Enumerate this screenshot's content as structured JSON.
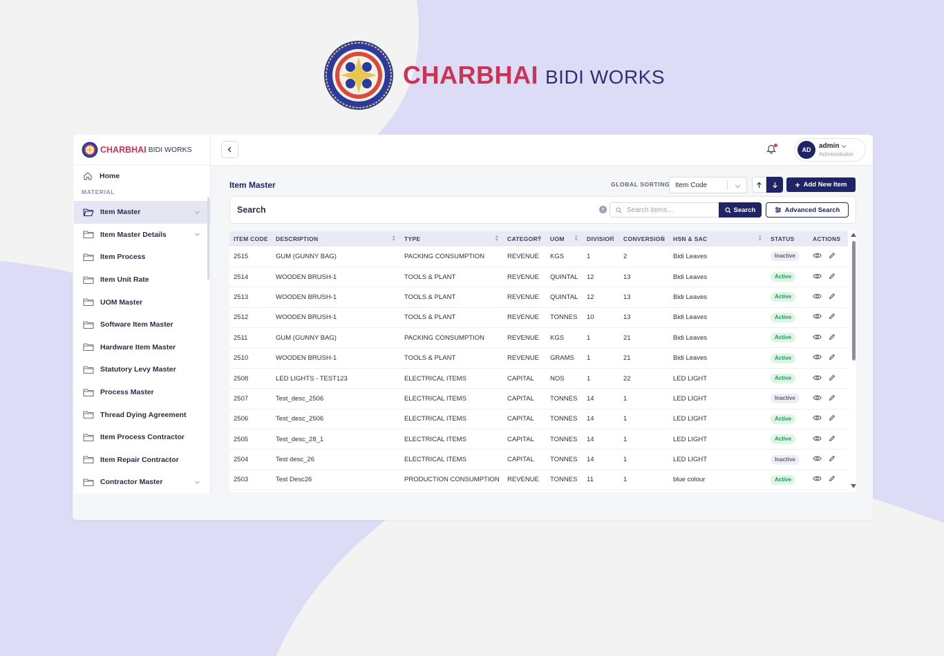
{
  "brand": {
    "name": "CHARBHAI",
    "sub": "BIDI WORKS"
  },
  "colors": {
    "primary": "#1e2466",
    "brand_red": "#c93556",
    "active_green": "#1e9a52",
    "lavender_bg": "#dcdcf6"
  },
  "sidebar": {
    "home": "Home",
    "section": "MATERIAL",
    "items": [
      {
        "label": "Item Master",
        "icon": "folder-open-icon",
        "has_chevron": true,
        "active": true
      },
      {
        "label": "Item Master Details",
        "icon": "folder-icon",
        "has_chevron": true
      },
      {
        "label": "Item Process",
        "icon": "folder-icon"
      },
      {
        "label": "Item Unit Rate",
        "icon": "folder-icon"
      },
      {
        "label": "UOM Master",
        "icon": "folder-icon"
      },
      {
        "label": "Software Item Master",
        "icon": "folder-icon"
      },
      {
        "label": "Hardware Item Master",
        "icon": "folder-icon"
      },
      {
        "label": "Statutory Levy Master",
        "icon": "folder-icon"
      },
      {
        "label": "Process Master",
        "icon": "folder-icon"
      },
      {
        "label": "Thread Dying Agreement",
        "icon": "folder-icon"
      },
      {
        "label": "Item Process Contractor",
        "icon": "folder-icon"
      },
      {
        "label": "Item Repair Contractor",
        "icon": "folder-icon"
      },
      {
        "label": "Contractor Master",
        "icon": "folder-icon",
        "has_chevron": true
      }
    ]
  },
  "topbar": {
    "user": {
      "initials": "AD",
      "name": "admin",
      "role": "Administrator"
    }
  },
  "main": {
    "title": "Item Master",
    "global_sorting_label": "GLOBAL SORTING",
    "sort_value": "Item Code",
    "add_button": "Add New Item",
    "search": {
      "title": "Search",
      "help": "?",
      "placeholder": "Search items...",
      "button": "Search",
      "advanced_button": "Advanced Search"
    }
  },
  "table": {
    "columns": [
      "ITEM CODE",
      "DESCRIPTION",
      "TYPE",
      "CATEGORY",
      "UOM",
      "DIVISION",
      "CONVERSION",
      "HSN & SAC",
      "STATUS",
      "ACTIONS"
    ],
    "rows": [
      [
        "2515",
        "GUM (GUNNY BAG)",
        "PACKING CONSUMPTION",
        "REVENUE",
        "KGS",
        "1",
        "2",
        "Bidi Leaves",
        "Inactive"
      ],
      [
        "2514",
        "WOODEN BRUSH-1",
        "TOOLS & PLANT",
        "REVENUE",
        "QUINTAL",
        "12",
        "13",
        "Bidi Leaves",
        "Active"
      ],
      [
        "2513",
        "WOODEN BRUSH-1",
        "TOOLS & PLANT",
        "REVENUE",
        "QUINTAL",
        "12",
        "13",
        "Bidi Leaves",
        "Active"
      ],
      [
        "2512",
        "WOODEN BRUSH-1",
        "TOOLS & PLANT",
        "REVENUE",
        "TONNES",
        "10",
        "13",
        "Bidi Leaves",
        "Active"
      ],
      [
        "2511",
        "GUM (GUNNY BAG)",
        "PACKING CONSUMPTION",
        "REVENUE",
        "KGS",
        "1",
        "21",
        "Bidi Leaves",
        "Active"
      ],
      [
        "2510",
        "WOODEN BRUSH-1",
        "TOOLS & PLANT",
        "REVENUE",
        "GRAMS",
        "1",
        "21",
        "Bidi Leaves",
        "Active"
      ],
      [
        "2508",
        "LED LIGHTS - TEST123",
        "ELECTRICAL ITEMS",
        "CAPITAL",
        "NOS",
        "1",
        "22",
        "LED LIGHT",
        "Active"
      ],
      [
        "2507",
        "Test_desc_2506",
        "ELECTRICAL ITEMS",
        "CAPITAL",
        "TONNES",
        "14",
        "1",
        "LED LIGHT",
        "Inactive"
      ],
      [
        "2506",
        "Test_desc_2506",
        "ELECTRICAL ITEMS",
        "CAPITAL",
        "TONNES",
        "14",
        "1",
        "LED LIGHT",
        "Active"
      ],
      [
        "2505",
        "Test_desc_28_1",
        "ELECTRICAL ITEMS",
        "CAPITAL",
        "TONNES",
        "14",
        "1",
        "LED LIGHT",
        "Active"
      ],
      [
        "2504",
        "Test desc_26",
        "ELECTRICAL ITEMS",
        "CAPITAL",
        "TONNES",
        "14",
        "1",
        "LED LIGHT",
        "Inactive"
      ],
      [
        "2503",
        "Test Desc26",
        "PRODUCTION CONSUMPTION",
        "REVENUE",
        "TONNES",
        "11",
        "1",
        "blue colour",
        "Active"
      ]
    ]
  }
}
